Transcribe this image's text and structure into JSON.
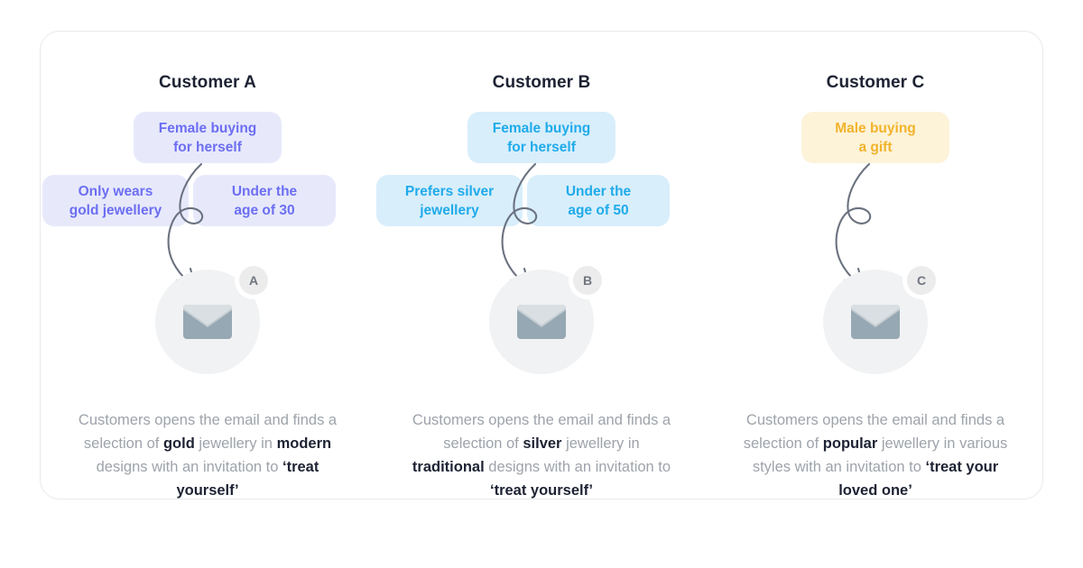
{
  "card": {
    "border_color": "#e7e9ec",
    "background": "#ffffff"
  },
  "columns": [
    {
      "id": "customer-a",
      "title": "Customer A",
      "theme": "indigo",
      "pill_bg": "#e7e9fb",
      "pill_text_color": "#6c6ef2",
      "pills": {
        "top": {
          "line1": "Female buying",
          "line2": "for herself"
        },
        "left": {
          "line1": "Only wears",
          "line2": "gold jewellery"
        },
        "right": {
          "line1": "Under the",
          "line2": "age of 30"
        }
      },
      "avatar": {
        "badge_label": "A",
        "icon": "envelope-icon"
      },
      "outcome": {
        "part1": "Customers opens the email and finds a selection of ",
        "bold1": "gold",
        "part2": " jewellery in ",
        "bold2": "modern",
        "part3": " designs with an invitation to ",
        "bold3": "‘treat yourself’"
      }
    },
    {
      "id": "customer-b",
      "title": "Customer B",
      "theme": "cyan",
      "pill_bg": "#d8eefb",
      "pill_text_color": "#1fabea",
      "pills": {
        "top": {
          "line1": "Female buying",
          "line2": "for herself"
        },
        "left": {
          "line1": "Prefers silver",
          "line2": "jewellery"
        },
        "right": {
          "line1": "Under the",
          "line2": "age of 50"
        }
      },
      "avatar": {
        "badge_label": "B",
        "icon": "envelope-icon"
      },
      "outcome": {
        "part1": "Customers opens the email and finds a selection of ",
        "bold1": "silver",
        "part2": " jewellery in ",
        "bold2": "traditional",
        "part3": " designs with an invitation to ",
        "bold3": "‘treat yourself’"
      }
    },
    {
      "id": "customer-c",
      "title": "Customer C",
      "theme": "amber",
      "pill_bg": "#fdf3d9",
      "pill_text_color": "#f2b32b",
      "pills": {
        "top": {
          "line1": "Male buying",
          "line2": "a gift"
        },
        "left": null,
        "right": null
      },
      "avatar": {
        "badge_label": "C",
        "icon": "envelope-icon"
      },
      "outcome": {
        "part1": "Customers opens the email and finds a selection of ",
        "bold1": "popular",
        "part2": " jewellery in various ",
        "bold2": "",
        "part3": "styles with an invitation to ",
        "bold3": "‘treat your loved one’"
      }
    }
  ],
  "connector": {
    "name": "curved-arrow-icon",
    "stroke_color": "#6b7280"
  }
}
